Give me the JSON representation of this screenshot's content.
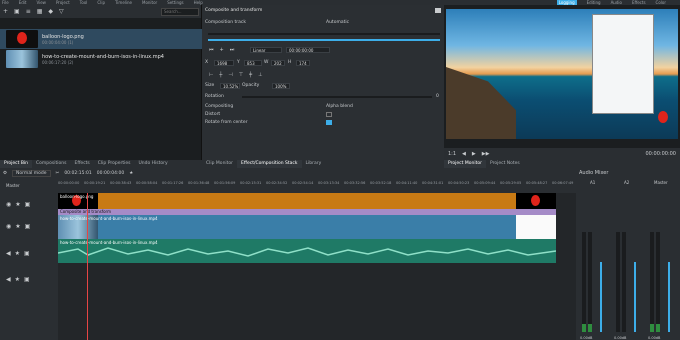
{
  "menubar": {
    "left_items": [
      "File",
      "Edit",
      "View",
      "Project",
      "Tool",
      "Clip",
      "Timeline",
      "Monitor",
      "Settings",
      "Help"
    ],
    "right_items": [
      "Logging",
      "Editing",
      "Audio",
      "Effects",
      "Color"
    ],
    "active": "Logging"
  },
  "bin": {
    "search_placeholder": "Search...",
    "clips": [
      {
        "name": "balloon-logo.png",
        "sub": "00:00:04:00 (1)"
      },
      {
        "name": "how-to-create-mount-and-burn-isos-in-linux.mp4",
        "sub": "00:06:17:20 (2)"
      }
    ]
  },
  "composite": {
    "title": "Composite and transform",
    "comp_track_label": "Composition track",
    "comp_track_value": "Automatic",
    "keyframe_interp": "Linear",
    "timecode": "00:00:00:00",
    "x_label": "X",
    "x_value": "1698",
    "y_label": "Y",
    "y_value": "853",
    "w_label": "W",
    "w_value": "202",
    "h_label": "H",
    "h_value": "174",
    "size_label": "Size",
    "size_value": "10.52%",
    "opacity_label": "Opacity",
    "opacity_value": "100%",
    "rotation_label": "Rotation",
    "rotation_value": "0",
    "compositing_label": "Compositing",
    "compositing_value": "Alpha blend",
    "distort_label": "Distort",
    "rotate_label": "Rotate from center"
  },
  "monitor": {
    "zoom": "1:1",
    "timecode": "00:00:00:00"
  },
  "tabs_left": [
    "Project Bin",
    "Compositions",
    "Effects",
    "Clip Properties",
    "Undo History"
  ],
  "tabs_left_active": "Project Bin",
  "tabs_mid": [
    "Clip Monitor",
    "Effect/Composition Stack",
    "Library"
  ],
  "tabs_mid_active": "Effect/Composition Stack",
  "tabs_right": [
    "Project Monitor",
    "Project Notes"
  ],
  "tabs_right_active": "Project Monitor",
  "timeline": {
    "mode": "Normal mode",
    "timecode1": "00:02:15:01",
    "timecode2": "00:00:04:00",
    "master_label": "Master",
    "ruler_ticks": [
      "00:00:00:00",
      "00:00:19:21",
      "00:00:38:43",
      "00:00:58:04",
      "00:01:17:26",
      "00:01:36:48",
      "00:01:56:09",
      "00:02:15:31",
      "00:02:34:52",
      "00:02:54:14",
      "00:03:13:34",
      "00:03:32:56",
      "00:03:52:18",
      "00:04:11:40",
      "00:04:31:01",
      "00:04:50:23",
      "00:05:09:44",
      "00:05:29:05",
      "00:05:48:27",
      "00:06:07:49"
    ],
    "clip_logo": "balloon-logo.png",
    "clip_composite": "Composite and transform",
    "clip_video": "how-to-create-mount-and-burn-isos-in-linux.mp4",
    "clip_audio": "how-to-create-mount-and-burn-isos-in-linux.mp4"
  },
  "mixer": {
    "title": "Audio Mixer",
    "strips": [
      "A1",
      "A2",
      "Master"
    ],
    "db": [
      "0.00dB",
      "0.00dB",
      "0.00dB"
    ]
  },
  "colors": {
    "accent": "#3daee9",
    "clip_orange": "#c87a14",
    "clip_blue": "#3a7ea8",
    "audio_green": "#1f7a66",
    "composite_purple": "#a58bc7"
  }
}
